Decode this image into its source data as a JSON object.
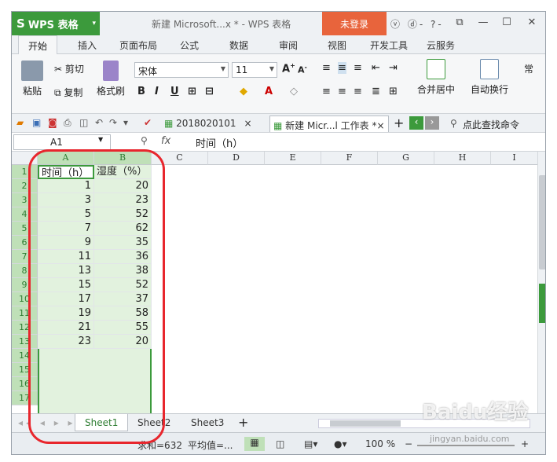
{
  "app": {
    "logo": "WPS 表格",
    "title": "新建 Microsoft...x * - WPS 表格",
    "login": "未登录",
    "title_icons": "ⓥ ⓓ- ?-"
  },
  "menu_tabs": [
    "开始",
    "插入",
    "页面布局",
    "公式",
    "数据",
    "审阅",
    "视图",
    "开发工具",
    "云服务"
  ],
  "ribbon": {
    "paste": "粘贴",
    "cut": "剪切",
    "copy": "复制",
    "format_painter": "格式刷",
    "font": "宋体",
    "size": "11",
    "merge": "合并居中",
    "wrap": "自动换行",
    "normal": "常"
  },
  "doc_tabs": [
    "2018020101",
    "新建 Micr...l 工作表 *"
  ],
  "search": "点此查找命令",
  "formula_bar": {
    "cell": "A1",
    "fx": "fx",
    "value": "时间（h）"
  },
  "columns": [
    "A",
    "B",
    "C",
    "D",
    "E",
    "F",
    "G",
    "H",
    "I"
  ],
  "rows": [
    "1",
    "2",
    "3",
    "4",
    "5",
    "6",
    "7",
    "8",
    "9",
    "10",
    "11",
    "12",
    "13",
    "14",
    "15",
    "16",
    "17"
  ],
  "header": [
    "时间（h）",
    "湿度（%）"
  ],
  "table": [
    [
      "1",
      "20"
    ],
    [
      "3",
      "23"
    ],
    [
      "5",
      "52"
    ],
    [
      "7",
      "62"
    ],
    [
      "9",
      "35"
    ],
    [
      "11",
      "36"
    ],
    [
      "13",
      "38"
    ],
    [
      "15",
      "52"
    ],
    [
      "17",
      "37"
    ],
    [
      "19",
      "58"
    ],
    [
      "21",
      "55"
    ],
    [
      "23",
      "20"
    ]
  ],
  "sheets": [
    "Sheet1",
    "Sheet2",
    "Sheet3"
  ],
  "status": {
    "sum": "求和=632",
    "avg": "平均值=...",
    "zoom": "100 %"
  },
  "watermark": {
    "brand": "Baidu经验",
    "url": "jingyan.baidu.com"
  },
  "colors": {
    "accent": "#3c9a3c",
    "login": "#e8643c",
    "selection": "#e2f2de",
    "annotation": "#e8262d"
  }
}
